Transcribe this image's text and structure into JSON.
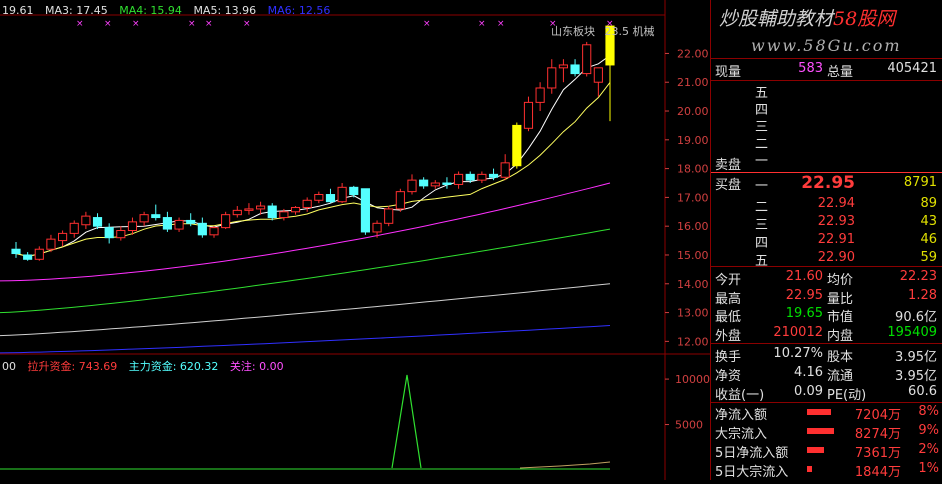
{
  "ma_legend": {
    "prefix": "19.61",
    "ma3": "MA3: 17.45",
    "ma4": "MA4: 15.94",
    "ma5": "MA5: 13.96",
    "ma6": "MA6: 12.56"
  },
  "indicator_legend": {
    "prefix": "00",
    "lift": "拉升资金: 743.69",
    "main": "主力资金: 620.32",
    "focus": "关注: 0.00"
  },
  "chart_labels": {
    "sector": "山东板块",
    "price_tag": "23.5",
    "industry": "机械"
  },
  "price_axis": [
    "22.00",
    "21.00",
    "20.00",
    "19.00",
    "18.00",
    "17.00",
    "16.00",
    "15.00",
    "14.00",
    "13.00",
    "12.00"
  ],
  "indicator_axis": [
    "10000",
    "5000"
  ],
  "colors": {
    "up": "#ff3030",
    "down": "#54ffff",
    "limit": "#ffff00",
    "ma_white": "#ffffff",
    "ma_yellow": "#ffff60",
    "ma_magenta": "#ff30ff",
    "ma_green": "#30e030",
    "ma_gray": "#d0d0d0",
    "ma_blue": "#3030ff"
  },
  "brand": {
    "text_a": "炒股輔助教材",
    "text_b": "58股网",
    "url": "www.58Gu.com"
  },
  "quote": {
    "volume_label": "现量",
    "volume": "583",
    "total_label": "总量",
    "total": "405421"
  },
  "sell_levels": [
    "五",
    "四",
    "三",
    "二",
    "一"
  ],
  "sell_label": "卖盘",
  "buy_label": "买盘",
  "buy_levels": [
    {
      "level": "一",
      "price": "22.95",
      "vol": "8791"
    },
    {
      "level": "二",
      "price": "22.94",
      "vol": "89"
    },
    {
      "level": "三",
      "price": "22.93",
      "vol": "43"
    },
    {
      "level": "四",
      "price": "22.91",
      "vol": "46"
    },
    {
      "level": "五",
      "price": "22.90",
      "vol": "59"
    }
  ],
  "stats": [
    {
      "l1": "今开",
      "v1": "21.60",
      "l2": "均价",
      "v2": "22.23"
    },
    {
      "l1": "最高",
      "v1": "22.95",
      "l2": "量比",
      "v2": "1.28"
    },
    {
      "l1": "最低",
      "v1": "19.65",
      "l2": "市值",
      "v2": "90.6亿"
    },
    {
      "l1": "外盘",
      "v1": "210012",
      "l2": "内盘",
      "v2": "195409"
    }
  ],
  "stats2": [
    {
      "l1": "换手",
      "v1": "10.27%",
      "l2": "股本",
      "v2": "3.95亿"
    },
    {
      "l1": "净资",
      "v1": "4.16",
      "l2": "流通",
      "v2": "3.95亿"
    },
    {
      "l1": "收益(一)",
      "v1": "0.09",
      "l2": "PE(动)",
      "v2": "60.6"
    }
  ],
  "flows": [
    {
      "label": "净流入额",
      "value": "7204万",
      "pct": "8%",
      "bar": 0.8
    },
    {
      "label": "大宗流入",
      "value": "8274万",
      "pct": "9%",
      "bar": 0.9
    },
    {
      "label": "5日净流入额",
      "value": "7361万",
      "pct": "2%",
      "bar": 0.55
    },
    {
      "label": "5日大宗流入",
      "value": "1844万",
      "pct": "1%",
      "bar": 0.15
    }
  ],
  "chart_data": {
    "type": "candlestick",
    "candles": [
      [
        15.2,
        15.45,
        14.9,
        15.05
      ],
      [
        15.0,
        15.1,
        14.8,
        14.85
      ],
      [
        14.85,
        15.3,
        14.8,
        15.2
      ],
      [
        15.2,
        15.7,
        15.1,
        15.55
      ],
      [
        15.5,
        15.85,
        15.3,
        15.75
      ],
      [
        15.75,
        16.2,
        15.6,
        16.1
      ],
      [
        16.05,
        16.5,
        15.9,
        16.35
      ],
      [
        16.3,
        16.45,
        15.9,
        16.0
      ],
      [
        15.95,
        16.1,
        15.4,
        15.6
      ],
      [
        15.6,
        16.0,
        15.5,
        15.85
      ],
      [
        15.85,
        16.3,
        15.7,
        16.15
      ],
      [
        16.15,
        16.5,
        16.0,
        16.4
      ],
      [
        16.4,
        16.75,
        16.2,
        16.3
      ],
      [
        16.3,
        16.5,
        15.8,
        15.9
      ],
      [
        15.9,
        16.3,
        15.8,
        16.2
      ],
      [
        16.2,
        16.45,
        16.0,
        16.1
      ],
      [
        16.1,
        16.3,
        15.6,
        15.7
      ],
      [
        15.7,
        16.0,
        15.6,
        15.95
      ],
      [
        15.95,
        16.5,
        15.9,
        16.4
      ],
      [
        16.4,
        16.7,
        16.3,
        16.55
      ],
      [
        16.55,
        16.8,
        16.4,
        16.6
      ],
      [
        16.6,
        16.85,
        16.4,
        16.7
      ],
      [
        16.7,
        16.8,
        16.2,
        16.3
      ],
      [
        16.3,
        16.6,
        16.2,
        16.5
      ],
      [
        16.5,
        16.7,
        16.4,
        16.65
      ],
      [
        16.65,
        17.0,
        16.5,
        16.9
      ],
      [
        16.9,
        17.2,
        16.8,
        17.1
      ],
      [
        17.1,
        17.3,
        16.8,
        16.85
      ],
      [
        16.85,
        17.5,
        16.8,
        17.35
      ],
      [
        17.35,
        17.4,
        17.0,
        17.1
      ],
      [
        17.3,
        17.3,
        15.7,
        15.8
      ],
      [
        15.8,
        16.2,
        15.6,
        16.1
      ],
      [
        16.1,
        16.7,
        16.0,
        16.6
      ],
      [
        16.6,
        17.3,
        16.5,
        17.2
      ],
      [
        17.2,
        17.8,
        17.1,
        17.6
      ],
      [
        17.6,
        17.7,
        17.3,
        17.4
      ],
      [
        17.4,
        17.6,
        17.3,
        17.5
      ],
      [
        17.5,
        17.7,
        17.3,
        17.45
      ],
      [
        17.45,
        17.9,
        17.3,
        17.8
      ],
      [
        17.8,
        17.9,
        17.5,
        17.6
      ],
      [
        17.6,
        17.9,
        17.5,
        17.8
      ],
      [
        17.8,
        18.0,
        17.6,
        17.7
      ],
      [
        17.7,
        18.5,
        17.6,
        18.2
      ],
      [
        18.1,
        19.6,
        18.0,
        19.5
      ],
      [
        19.4,
        20.5,
        19.3,
        20.3
      ],
      [
        20.3,
        21.0,
        20.0,
        20.8
      ],
      [
        20.8,
        21.8,
        20.6,
        21.5
      ],
      [
        21.5,
        21.8,
        21.0,
        21.6
      ],
      [
        21.6,
        21.8,
        21.2,
        21.3
      ],
      [
        21.3,
        22.4,
        21.2,
        22.3
      ],
      [
        21.0,
        21.5,
        20.5,
        21.5
      ],
      [
        21.6,
        22.95,
        19.65,
        22.95
      ]
    ]
  }
}
